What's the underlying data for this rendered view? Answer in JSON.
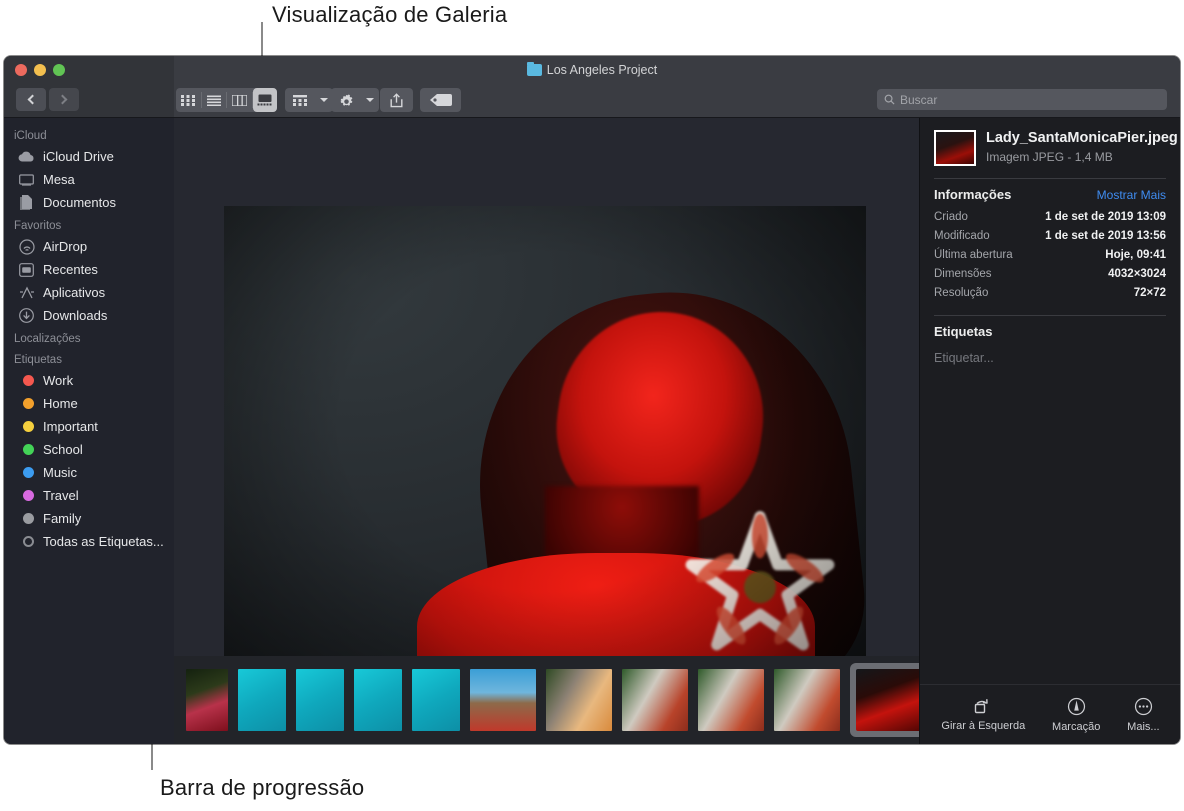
{
  "annotations": {
    "top": "Visualização de Galeria",
    "bottom": "Barra de progressão"
  },
  "window": {
    "title": "Los Angeles Project",
    "folder_icon": "folder-icon",
    "traffic_lights": [
      "close-red",
      "minimize-yellow",
      "maximize-green"
    ]
  },
  "toolbar": {
    "back": "back-chevron-icon",
    "forward": "forward-chevron-icon",
    "views": [
      {
        "name": "icon-view",
        "label": "Visualização de Ícones",
        "selected": false
      },
      {
        "name": "list-view",
        "label": "Visualização de Lista",
        "selected": false
      },
      {
        "name": "column-view",
        "label": "Visualização de Colunas",
        "selected": false
      },
      {
        "name": "gallery-view",
        "label": "Visualização de Galeria",
        "selected": true
      }
    ],
    "group_button": "group-items-icon",
    "action_button": "gear-icon",
    "share_button": "share-icon",
    "tag_button": "tag-icon"
  },
  "search": {
    "placeholder": "Buscar",
    "icon": "search-icon"
  },
  "sidebar": {
    "sections": [
      {
        "header": "iCloud",
        "items": [
          {
            "label": "iCloud Drive",
            "icon": "cloud-icon"
          },
          {
            "label": "Mesa",
            "icon": "desktop-icon"
          },
          {
            "label": "Documentos",
            "icon": "documents-icon"
          }
        ]
      },
      {
        "header": "Favoritos",
        "items": [
          {
            "label": "AirDrop",
            "icon": "airdrop-icon"
          },
          {
            "label": "Recentes",
            "icon": "recents-icon"
          },
          {
            "label": "Aplicativos",
            "icon": "applications-icon"
          },
          {
            "label": "Downloads",
            "icon": "downloads-icon"
          }
        ]
      },
      {
        "header": "Localizações",
        "items": []
      },
      {
        "header": "Etiquetas",
        "items": [
          {
            "label": "Work",
            "color": "#f5584f"
          },
          {
            "label": "Home",
            "color": "#f3a02c"
          },
          {
            "label": "Important",
            "color": "#f5cf3e"
          },
          {
            "label": "School",
            "color": "#43d357"
          },
          {
            "label": "Music",
            "color": "#3c9cf0"
          },
          {
            "label": "Travel",
            "color": "#d濃"
          },
          {
            "label": "Family",
            "color": "#9a9ca1"
          },
          {
            "label": "Todas as Etiquetas...",
            "color": "hollow"
          }
        ]
      }
    ]
  },
  "preview": {
    "alt": "Retrato de mulher iluminada em vermelho ao anoitecer"
  },
  "filmstrip": {
    "thumbnails": [
      {
        "name": "thumb-1",
        "selected": false
      },
      {
        "name": "thumb-2",
        "selected": false
      },
      {
        "name": "thumb-3",
        "selected": false
      },
      {
        "name": "thumb-4",
        "selected": false
      },
      {
        "name": "thumb-5",
        "selected": false
      },
      {
        "name": "thumb-6",
        "selected": false
      },
      {
        "name": "thumb-7",
        "selected": false
      },
      {
        "name": "thumb-8",
        "selected": false
      },
      {
        "name": "thumb-9",
        "selected": false
      },
      {
        "name": "thumb-10",
        "selected": false
      },
      {
        "name": "thumb-11",
        "selected": false
      },
      {
        "name": "thumb-12-selected",
        "selected": true
      }
    ]
  },
  "info": {
    "filename": "Lady_SantaMonicaPier.jpeg",
    "kind": "Imagem JPEG - 1,4 MB",
    "section_title": "Informações",
    "show_more": "Mostrar Mais",
    "rows": [
      {
        "key": "Criado",
        "value": "1 de set de 2019 13:09"
      },
      {
        "key": "Modificado",
        "value": "1 de set de 2019 13:56"
      },
      {
        "key": "Última abertura",
        "value": "Hoje, 09:41"
      },
      {
        "key": "Dimensões",
        "value": "4032×3024"
      },
      {
        "key": "Resolução",
        "value": "72×72"
      }
    ],
    "tags_title": "Etiquetas",
    "tags_placeholder": "Etiquetar..."
  },
  "actions": [
    {
      "label": "Girar à Esquerda",
      "icon": "rotate-left-icon"
    },
    {
      "label": "Marcação",
      "icon": "markup-icon"
    },
    {
      "label": "Mais...",
      "icon": "more-icon"
    }
  ]
}
